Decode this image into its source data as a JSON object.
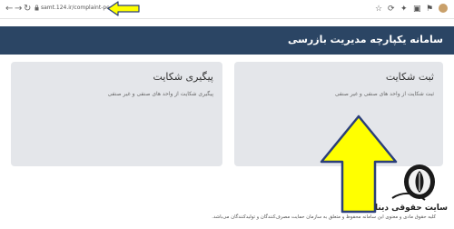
{
  "browser": {
    "back_icon": "←",
    "forward_icon": "→",
    "reload_icon": "↻",
    "url": "samt.124.ir/complaint-people",
    "toolbar_icons": [
      "☆",
      "⟳",
      "✦",
      "▣",
      "⚑"
    ]
  },
  "header": {
    "title": "سامانه یکپارچه مدیریت بازرسی"
  },
  "cards": [
    {
      "title": "ثبت شکایت",
      "text": "ثبت شکایت از واحد های صنفی و غیر صنفی"
    },
    {
      "title": "پیگیری شکایت",
      "text": "پیگیری شکایت از واحد های صنفی و غیر صنفی"
    }
  ],
  "footer": {
    "text": "کلیه حقوق مادی و معنوی این سامانه محفوظ و متعلق به سازمان حمایت مصرف‌کنندگان و تولیدکنندگان می‌باشد."
  },
  "watermark": {
    "text": "سایت حقوقی دینا"
  },
  "colors": {
    "header_bg": "#2b4564",
    "card_bg": "#e4e6ea",
    "arrow_fill": "#ffff00",
    "arrow_stroke": "#2b3f7a"
  }
}
